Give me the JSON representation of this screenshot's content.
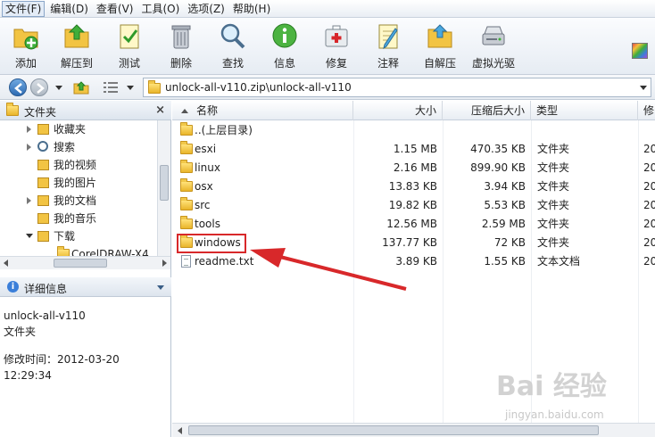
{
  "menu": [
    "文件(F)",
    "编辑(D)",
    "查看(V)",
    "工具(O)",
    "选项(Z)",
    "帮助(H)"
  ],
  "toolbar": [
    {
      "label": "添加",
      "icon": "add-icon"
    },
    {
      "label": "解压到",
      "icon": "extract-to-icon"
    },
    {
      "label": "测试",
      "icon": "test-icon"
    },
    {
      "label": "删除",
      "icon": "delete-icon"
    },
    {
      "label": "查找",
      "icon": "find-icon"
    },
    {
      "label": "信息",
      "icon": "info-icon"
    },
    {
      "label": "修复",
      "icon": "repair-icon"
    },
    {
      "label": "注释",
      "icon": "comment-icon"
    },
    {
      "label": "自解压",
      "icon": "sfx-icon"
    },
    {
      "label": "虚拟光驱",
      "icon": "virtual-drive-icon"
    }
  ],
  "address": {
    "path": "unlock-all-v110.zip\\unlock-all-v110"
  },
  "left": {
    "folders_title": "文件夹",
    "tree": [
      "收藏夹",
      "搜索",
      "我的视频",
      "我的图片",
      "我的文档",
      "我的音乐",
      "下载",
      "CorelDRAW-X4"
    ],
    "details_title": "详细信息",
    "details_name": "unlock-all-v110",
    "details_type": "文件夹",
    "details_modified": "修改时间：2012-03-20 12:29:34"
  },
  "columns": {
    "name": "名称",
    "size": "大小",
    "packed": "压缩后大小",
    "type": "类型",
    "modified": "修"
  },
  "files": [
    {
      "name": "..(上层目录)",
      "size": "",
      "packed": "",
      "type": "",
      "mod": "",
      "kind": "folder"
    },
    {
      "name": "esxi",
      "size": "1.15 MB",
      "packed": "470.35 KB",
      "type": "文件夹",
      "mod": "20",
      "kind": "folder"
    },
    {
      "name": "linux",
      "size": "2.16 MB",
      "packed": "899.90 KB",
      "type": "文件夹",
      "mod": "20",
      "kind": "folder"
    },
    {
      "name": "osx",
      "size": "13.83 KB",
      "packed": "3.94 KB",
      "type": "文件夹",
      "mod": "20",
      "kind": "folder"
    },
    {
      "name": "src",
      "size": "19.82 KB",
      "packed": "5.53 KB",
      "type": "文件夹",
      "mod": "20",
      "kind": "folder"
    },
    {
      "name": "tools",
      "size": "12.56 MB",
      "packed": "2.59 MB",
      "type": "文件夹",
      "mod": "20",
      "kind": "folder"
    },
    {
      "name": "windows",
      "size": "137.77 KB",
      "packed": "72 KB",
      "type": "文件夹",
      "mod": "20",
      "kind": "folder"
    },
    {
      "name": "readme.txt",
      "size": "3.89 KB",
      "packed": "1.55 KB",
      "type": "文本文档",
      "mod": "20",
      "kind": "text"
    }
  ],
  "watermark": {
    "brand": "Bai 经验",
    "url": "jingyan.baidu.com"
  },
  "colors": {
    "accent_red": "#d8282a",
    "folder": "#f2c443"
  }
}
